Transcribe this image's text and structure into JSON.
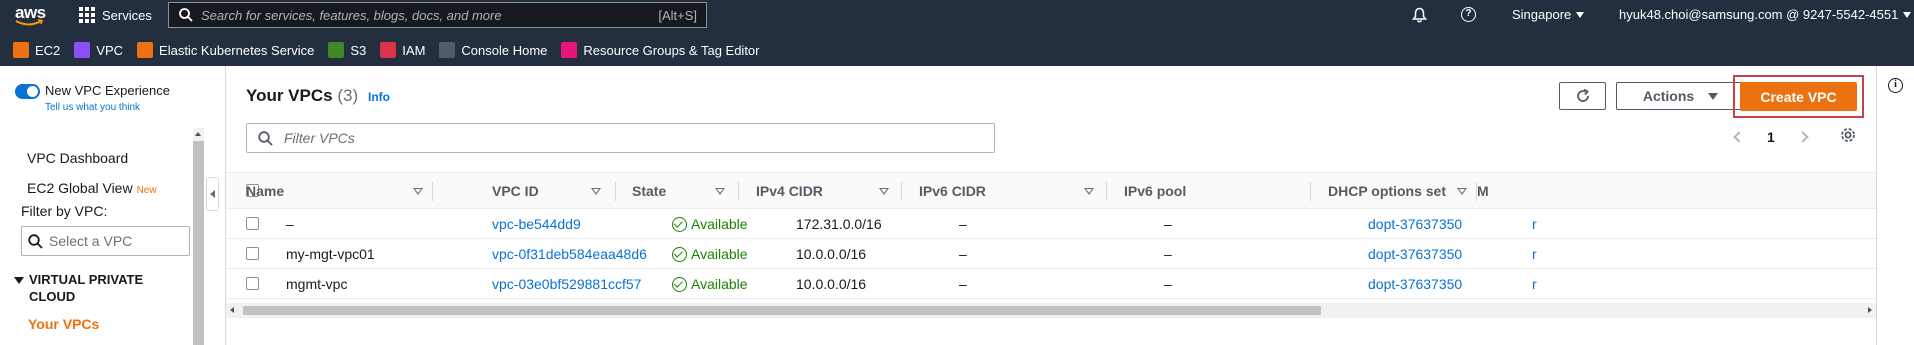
{
  "topnav": {
    "logo_text": "aws",
    "services_label": "Services",
    "search_placeholder": "Search for services, features, blogs, docs, and more",
    "search_shortcut": "[Alt+S]",
    "region": "Singapore",
    "account": "hyuk48.choi@samsung.com @ 9247-5542-4551"
  },
  "favorites": [
    {
      "label": "EC2",
      "icon": "ec2-icon",
      "color": "#ec7211"
    },
    {
      "label": "VPC",
      "icon": "vpc-icon",
      "color": "#8c4fff"
    },
    {
      "label": "Elastic Kubernetes Service",
      "icon": "eks-icon",
      "color": "#ec7211"
    },
    {
      "label": "S3",
      "icon": "s3-icon",
      "color": "#3f8624"
    },
    {
      "label": "IAM",
      "icon": "iam-icon",
      "color": "#dd344c"
    },
    {
      "label": "Console Home",
      "icon": "console-home-icon",
      "color": "#545b64"
    },
    {
      "label": "Resource Groups & Tag Editor",
      "icon": "resource-groups-icon",
      "color": "#e7157b"
    }
  ],
  "sidebar": {
    "new_experience_label": "New VPC Experience",
    "tell_us": "Tell us what you think",
    "dashboard": "VPC Dashboard",
    "global_view": "EC2 Global View",
    "new_badge": "New",
    "filter_label": "Filter by VPC:",
    "filter_placeholder": "Select a VPC",
    "section_line1": "VIRTUAL PRIVATE",
    "section_line2": "CLOUD",
    "active_item": "Your VPCs"
  },
  "panel": {
    "title": "Your VPCs",
    "count": "(3)",
    "info": "Info",
    "actions_label": "Actions",
    "create_label": "Create VPC",
    "filter_placeholder": "Filter VPCs",
    "page": "1"
  },
  "table": {
    "columns": [
      "Name",
      "VPC ID",
      "State",
      "IPv4 CIDR",
      "IPv6 CIDR",
      "IPv6 pool",
      "DHCP options set",
      "M"
    ],
    "rows": [
      {
        "name": "–",
        "vpc_id": "vpc-be544dd9",
        "state": "Available",
        "ipv4": "172.31.0.0/16",
        "ipv6": "–",
        "pool": "–",
        "dhcp": "dopt-37637350",
        "extra": "r"
      },
      {
        "name": "my-mgt-vpc01",
        "vpc_id": "vpc-0f31deb584eaa48d6",
        "state": "Available",
        "ipv4": "10.0.0.0/16",
        "ipv6": "–",
        "pool": "–",
        "dhcp": "dopt-37637350",
        "extra": "r"
      },
      {
        "name": "mgmt-vpc",
        "vpc_id": "vpc-03e0bf529881ccf57",
        "state": "Available",
        "ipv4": "10.0.0.0/16",
        "ipv6": "–",
        "pool": "–",
        "dhcp": "dopt-37637350",
        "extra": "r"
      }
    ]
  },
  "colors": {
    "accent": "#ec7211",
    "link": "#0972d3",
    "success": "#1d8102",
    "nav_bg": "#232f3e"
  }
}
